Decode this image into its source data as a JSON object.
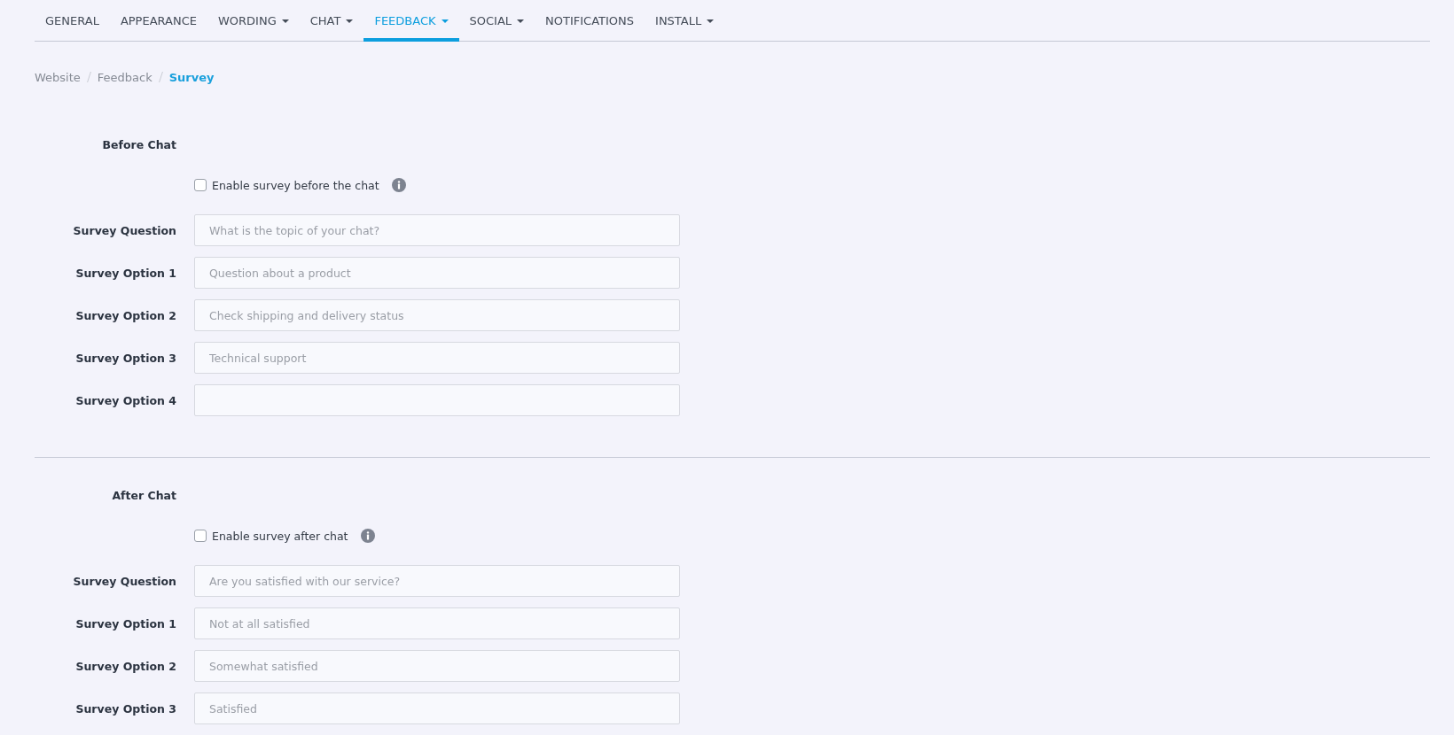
{
  "tabs": [
    {
      "label": "GENERAL",
      "selected": false,
      "dropdown": false
    },
    {
      "label": "APPEARANCE",
      "selected": false,
      "dropdown": false
    },
    {
      "label": "WORDING",
      "selected": false,
      "dropdown": true
    },
    {
      "label": "CHAT",
      "selected": false,
      "dropdown": true
    },
    {
      "label": "FEEDBACK",
      "selected": true,
      "dropdown": true
    },
    {
      "label": "SOCIAL",
      "selected": false,
      "dropdown": true
    },
    {
      "label": "NOTIFICATIONS",
      "selected": false,
      "dropdown": false
    },
    {
      "label": "INSTALL",
      "selected": false,
      "dropdown": true
    }
  ],
  "breadcrumb": [
    {
      "label": "Website",
      "selected": false
    },
    {
      "label": "Feedback",
      "selected": false
    },
    {
      "label": "Survey",
      "selected": true
    }
  ],
  "sections": [
    {
      "title": "Before Chat",
      "checkbox": {
        "label": "Enable survey before the chat",
        "checked": false
      },
      "fields": [
        {
          "label": "Survey Question",
          "placeholder": "What is the topic of your chat?"
        },
        {
          "label": "Survey Option 1",
          "placeholder": "Question about a product"
        },
        {
          "label": "Survey Option 2",
          "placeholder": "Check shipping and delivery status"
        },
        {
          "label": "Survey Option 3",
          "placeholder": "Technical support"
        },
        {
          "label": "Survey Option 4"
        }
      ]
    },
    {
      "title": "After Chat",
      "checkbox": {
        "label": "Enable survey after chat",
        "checked": false
      },
      "fields": [
        {
          "label": "Survey Question",
          "placeholder": "Are you satisfied with our service?"
        },
        {
          "label": "Survey Option 1",
          "placeholder": "Not at all satisfied"
        },
        {
          "label": "Survey Option 2",
          "placeholder": "Somewhat satisfied"
        },
        {
          "label": "Survey Option 3",
          "placeholder": "Satisfied"
        }
      ]
    }
  ]
}
